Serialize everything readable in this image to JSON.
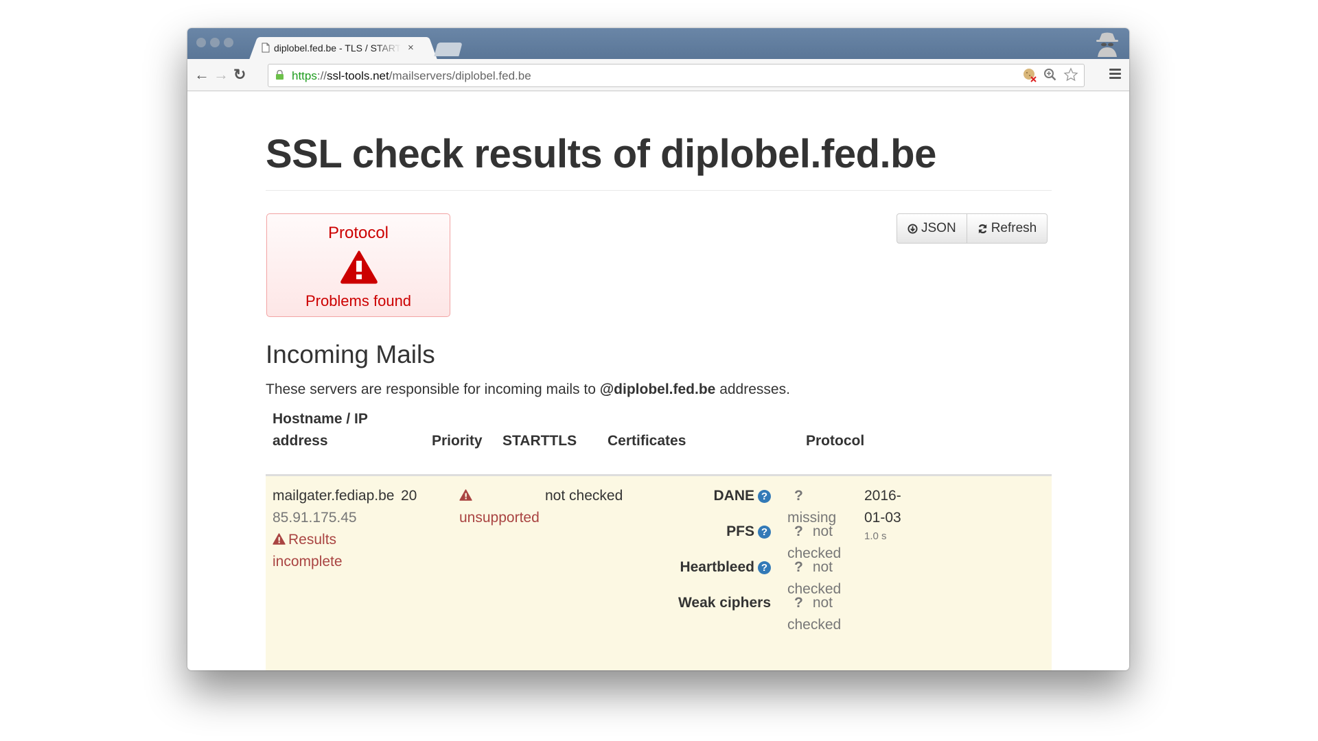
{
  "browser": {
    "tab_title": "diplobel.fed.be - TLS / STARTTLS",
    "tab_close": "×",
    "url": {
      "scheme": "https",
      "sep": "://",
      "host": "ssl-tools.net",
      "path": "/mailservers/diplobel.fed.be"
    },
    "icons": [
      "back-icon",
      "forward-icon",
      "reload-icon",
      "lock-icon",
      "cookie-blocked-icon",
      "zoom-icon",
      "star-icon",
      "menu-icon",
      "incognito-icon"
    ],
    "nav": {
      "back": "←",
      "forward": "→",
      "reload": "↻"
    }
  },
  "page": {
    "title": "SSL check results of diplobel.fed.be",
    "status_box": {
      "title": "Protocol",
      "text": "Problems found",
      "color": "#cc0000"
    },
    "buttons": {
      "json": "JSON",
      "refresh": "Refresh"
    },
    "section_title": "Incoming Mails",
    "lead": {
      "before": "These servers are responsible for incoming mails to ",
      "domain": "@diplobel.fed.be",
      "after": " addresses."
    },
    "table": {
      "headers": {
        "host_line1": "Hostname / IP",
        "host_line2": "address",
        "priority": "Priority",
        "starttls": "STARTTLS",
        "certificates": "Certificates",
        "protocol": "Protocol"
      },
      "rows": [
        {
          "hostname": "mailgater.fediap.be",
          "ip": "85.91.175.45",
          "warning_line1": "Results",
          "warning_line2": "incomplete",
          "priority": "20",
          "starttls": "unsupported",
          "certificates": "not checked",
          "protocol": [
            {
              "label": "DANE",
              "help": true,
              "mark": "?",
              "line1": "",
              "line2": "missing"
            },
            {
              "label": "PFS",
              "help": true,
              "mark": "?",
              "line1": "not",
              "line2": "checked"
            },
            {
              "label": "Heartbleed",
              "help": true,
              "mark": "?",
              "line1": "not",
              "line2": "checked"
            },
            {
              "label": "Weak ciphers",
              "help": false,
              "mark": "?",
              "line1": "not",
              "line2": "checked"
            }
          ],
          "date_line1": "2016-",
          "date_line2": "01-03",
          "duration": "1.0 s"
        }
      ]
    },
    "colors": {
      "warning_row": "#fcf8e3",
      "danger": "#a94442",
      "help_icon": "#337ab7"
    }
  }
}
